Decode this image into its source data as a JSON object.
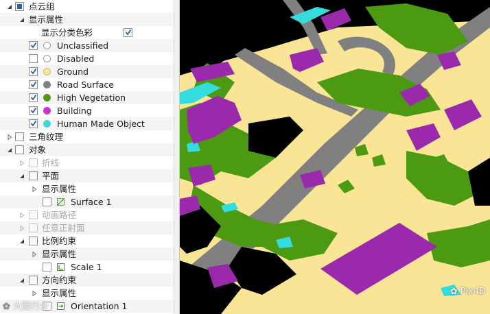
{
  "tree": {
    "point_group": "点云组",
    "display_props": "显示属性",
    "show_class_colors": "显示分类色彩",
    "classes": [
      {
        "label": "Unclassified",
        "color": "#ffffff",
        "checked": true
      },
      {
        "label": "Disabled",
        "color": "#ffffff",
        "checked": false
      },
      {
        "label": "Ground",
        "color": "#fae597",
        "checked": true
      },
      {
        "label": "Road Surface",
        "color": "#808080",
        "checked": true
      },
      {
        "label": "High Vegetation",
        "color": "#4c9a12",
        "checked": true
      },
      {
        "label": "Building",
        "color": "#cc33cc",
        "checked": true
      },
      {
        "label": "Human Made Object",
        "color": "#33dddd",
        "checked": true
      }
    ],
    "triangle_texture": "三角纹理",
    "objects": "对象",
    "polyline": "折线",
    "plane": "平面",
    "plane_display": "显示属性",
    "surface": "Surface 1",
    "animation_path": "动画路径",
    "ortho_plane": "任意正射面",
    "scale_constraint": "比例约束",
    "scale_display": "显示属性",
    "scale": "Scale 1",
    "orientation_constraint": "方向约束",
    "orientation_display": "显示属性",
    "orientation": "Orientation 1"
  },
  "watermark": {
    "left": "大疆行业",
    "right": "Pix4D"
  },
  "colors": {
    "ground": "#fae597",
    "road": "#808080",
    "vegetation": "#4c9a12",
    "building": "#9a2aab",
    "human_made": "#33dddd",
    "background": "#000000"
  }
}
